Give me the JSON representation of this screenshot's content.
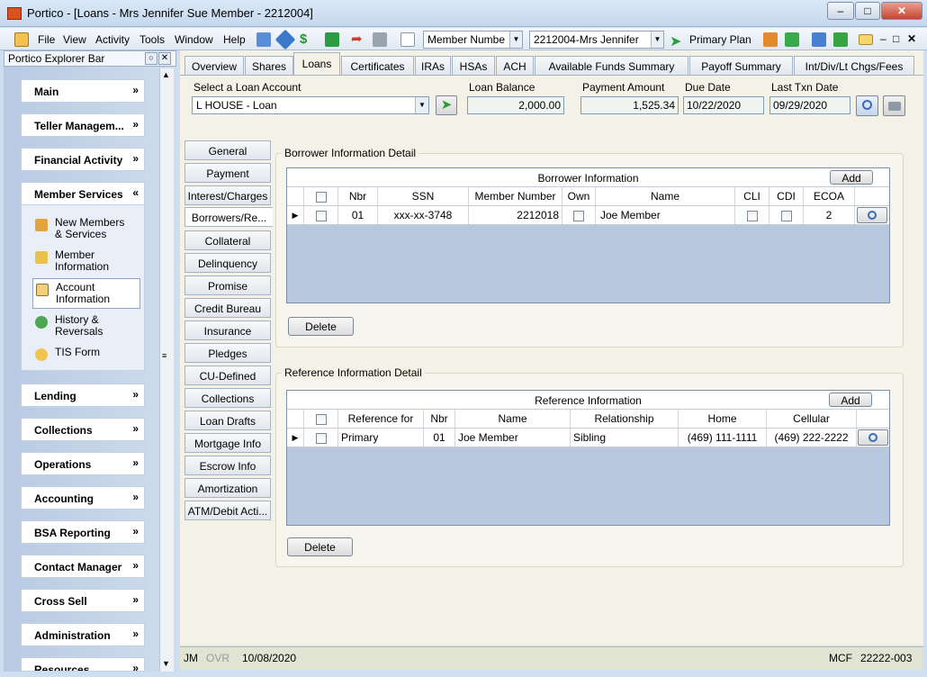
{
  "window": {
    "title": "Portico - [Loans - Mrs Jennifer Sue Member - 2212004]"
  },
  "menu": [
    "File",
    "View",
    "Activity",
    "Tools",
    "Window",
    "Help"
  ],
  "toolbar": {
    "search_type": "Member Numbe",
    "member_select": "2212004-Mrs Jennifer",
    "primary_plan": "Primary Plan"
  },
  "explorer": {
    "title": "Portico Explorer Bar",
    "groups": [
      "Main",
      "Teller Managem...",
      "Financial Activity",
      "Member Services",
      "Lending",
      "Collections",
      "Operations",
      "Accounting",
      "BSA Reporting",
      "Contact Manager",
      "Cross Sell",
      "Administration",
      "Resources"
    ],
    "member_items": [
      {
        "l1": "New Members",
        "l2": "& Services"
      },
      {
        "l1": "Member",
        "l2": "Information"
      },
      {
        "l1": "Account",
        "l2": "Information"
      },
      {
        "l1": "History &",
        "l2": "Reversals"
      },
      {
        "l1": "TIS Form",
        "l2": ""
      }
    ]
  },
  "tabs": [
    "Overview",
    "Shares",
    "Loans",
    "Certificates",
    "IRAs",
    "HSAs",
    "ACH",
    "Available Funds Summary",
    "Payoff Summary",
    "Int/Div/Lt Chgs/Fees"
  ],
  "loan": {
    "select_label": "Select a Loan Account",
    "account": "L   HOUSE - Loan",
    "balance_label": "Loan Balance",
    "balance": "2,000.00",
    "payment_label": "Payment Amount",
    "payment": "1,525.34",
    "due_label": "Due Date",
    "due": "10/22/2020",
    "last_label": "Last Txn Date",
    "last": "09/29/2020"
  },
  "side_tabs": [
    "General",
    "Payment",
    "Interest/Charges",
    "Borrowers/Re...",
    "Collateral",
    "Delinquency",
    "Promise",
    "Credit Bureau",
    "Insurance",
    "Pledges",
    "CU-Defined",
    "Collections",
    "Loan Drafts",
    "Mortgage Info",
    "Escrow Info",
    "Amortization",
    "ATM/Debit Acti..."
  ],
  "borrower": {
    "panel_title": "Borrower Information Detail",
    "grid_title": "Borrower Information",
    "add": "Add",
    "delete": "Delete",
    "columns": [
      "Nbr",
      "SSN",
      "Member Number",
      "Own",
      "Name",
      "CLI",
      "CDI",
      "ECOA"
    ],
    "row": {
      "nbr": "01",
      "ssn": "xxx-xx-3748",
      "member_number": "2212018",
      "name": "Joe Member",
      "ecoa": "2"
    }
  },
  "reference": {
    "panel_title": "Reference Information Detail",
    "grid_title": "Reference Information",
    "add": "Add",
    "delete": "Delete",
    "columns": [
      "Reference for",
      "Nbr",
      "Name",
      "Relationship",
      "Home",
      "Cellular"
    ],
    "row": {
      "ref_for": "Primary",
      "nbr": "01",
      "name": "Joe Member",
      "relationship": "Sibling",
      "home": "(469) 111-1111",
      "cellular": "(469) 222-2222"
    }
  },
  "status": {
    "user": "JM",
    "ovr": "OVR",
    "date": "10/08/2020",
    "mcf": "MCF",
    "code": "22222-003"
  }
}
